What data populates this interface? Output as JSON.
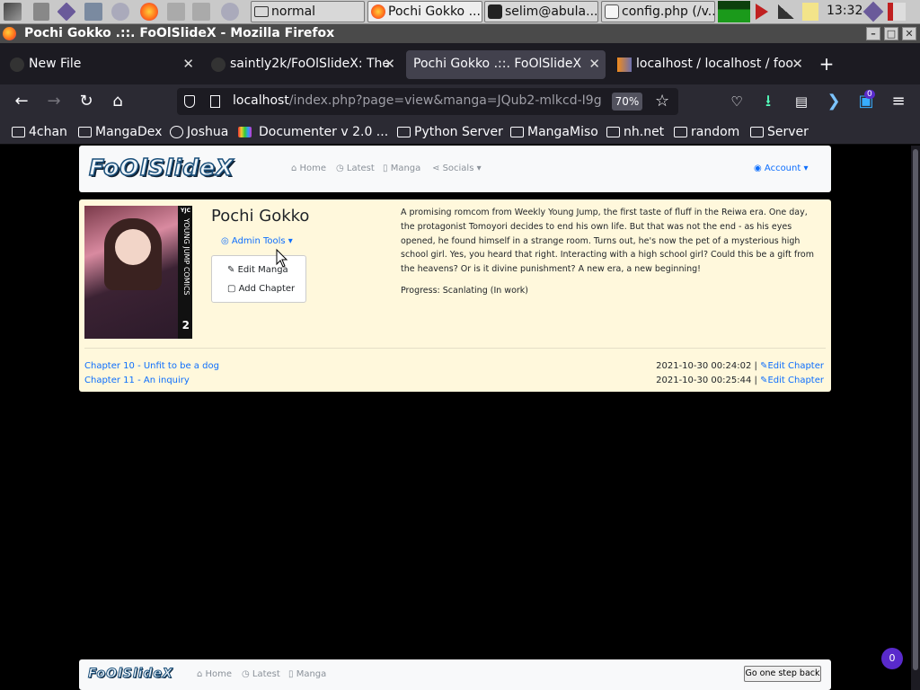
{
  "taskbar": {
    "windows": [
      {
        "label": "normal"
      },
      {
        "label": "Pochi Gokko ..."
      },
      {
        "label": "selim@abula..."
      },
      {
        "label": "config.php (/v..."
      }
    ],
    "clock": "13:32"
  },
  "window": {
    "title": "Pochi Gokko .::. FoOlSlideX - Mozilla Firefox"
  },
  "tabs": [
    {
      "label": "New File"
    },
    {
      "label": "saintly2k/FoOlSlideX: The"
    },
    {
      "label": "Pochi Gokko .::. FoOlSlideX"
    },
    {
      "label": "localhost / localhost / foo"
    }
  ],
  "new_tab": "+",
  "urlbar": {
    "host": "localhost",
    "path": "/index.php?page=view&manga=JQub2-mlkcd-I9g",
    "zoom": "70%"
  },
  "toolbar": {
    "notification_count": "0"
  },
  "bookmarks": [
    {
      "label": "4chan"
    },
    {
      "label": "MangaDex"
    },
    {
      "label": "Joshua"
    },
    {
      "label": "Documenter v 2.0 ..."
    },
    {
      "label": "Python Server"
    },
    {
      "label": "MangaMiso"
    },
    {
      "label": "nh.net"
    },
    {
      "label": "random"
    },
    {
      "label": "Server"
    }
  ],
  "site": {
    "logo": "FoOlSlideX",
    "nav": {
      "home": "Home",
      "latest": "Latest",
      "manga": "Manga",
      "socials": "Socials"
    },
    "account": "Account"
  },
  "manga": {
    "title": "Pochi Gokko",
    "cover_spine": "YOUNG JUMP COMICS",
    "cover_badge": "YJC",
    "cover_volume": "2",
    "admin_tools": "Admin Tools",
    "admin_menu": {
      "edit": "Edit Manga",
      "add": "Add Chapter"
    },
    "description": "A promising romcom from Weekly Young Jump, the first taste of fluff in the Reiwa era. One day, the protagonist Tomoyori decides to end his own life. But that was not the end - as his eyes opened, he found himself in a strange room. Turns out, he's now the pet of a mysterious high school girl. Yes, you heard that right. Interacting with a high school girl? Could this be a gift from the heavens? Or is it divine punishment? A new era, a new beginning!",
    "progress": "Progress: Scanlating (In work)",
    "chapters": [
      {
        "title": "Chapter 10 - Unfit to be a dog",
        "date": "2021-10-30 00:24:02 |",
        "edit": "Edit Chapter"
      },
      {
        "title": "Chapter 11 - An inquiry",
        "date": "2021-10-30 00:25:44 |",
        "edit": "Edit Chapter"
      }
    ]
  },
  "footer": {
    "logo": "FoOlSlideX",
    "nav": {
      "home": "Home",
      "latest": "Latest",
      "manga": "Manga"
    },
    "go_back": "Go one step back"
  },
  "badge_count": "0",
  "colors": {
    "accent": "#0d6efd",
    "page_bg": "#fff8dc",
    "browser_bg": "#2b2a33"
  }
}
